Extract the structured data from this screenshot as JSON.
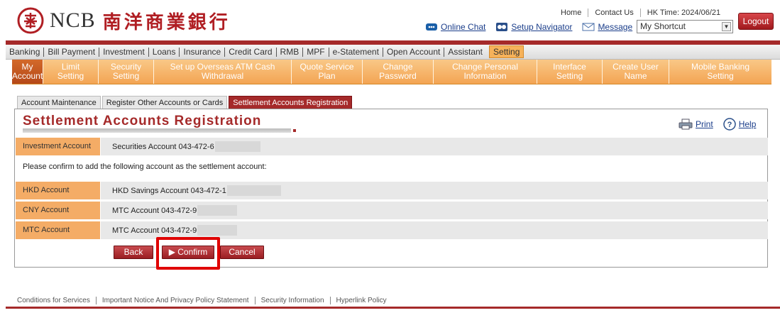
{
  "brand": {
    "name": "NCB",
    "chinese_name": "南洋商業銀行",
    "accent": "#a52a2a",
    "highlight": "#e00000"
  },
  "header": {
    "home": "Home",
    "contact": "Contact Us",
    "hk_time": "HK Time: 2024/06/21",
    "logout": "Logout",
    "tools": {
      "chat": "Online Chat",
      "navigator": "Setup Navigator",
      "message": "Message"
    },
    "shortcut": "My Shortcut"
  },
  "nav": {
    "items": [
      "Banking",
      "Bill Payment",
      "Investment",
      "Loans",
      "Insurance",
      "Credit Card",
      "RMB",
      "MPF",
      "e-Statement",
      "Open Account",
      "Assistant",
      "Setting"
    ]
  },
  "subnav": {
    "items": [
      {
        "l1": "My",
        "l2": "Account"
      },
      {
        "l1": "Limit",
        "l2": "Setting"
      },
      {
        "l1": "Security",
        "l2": "Setting"
      },
      {
        "l1": "Set up Overseas ATM Cash",
        "l2": "Withdrawal"
      },
      {
        "l1": "Quote Service",
        "l2": "Plan"
      },
      {
        "l1": "Change",
        "l2": "Password"
      },
      {
        "l1": "Change Personal",
        "l2": "Information"
      },
      {
        "l1": "Interface",
        "l2": "Setting"
      },
      {
        "l1": "Create User",
        "l2": "Name"
      },
      {
        "l1": "Mobile Banking",
        "l2": "Setting"
      }
    ]
  },
  "tabs": [
    "Account Maintenance",
    "Register Other Accounts or Cards",
    "Settlement Accounts Registration"
  ],
  "panel": {
    "title": "Settlement Accounts Registration",
    "print": "Print",
    "help": "Help",
    "investment_label": "Investment Account",
    "investment_value": "Securities Account 043-472-6",
    "confirm_text": "Please confirm to add the following account as the settlement account:",
    "rows": [
      {
        "label": "HKD Account",
        "value": "HKD Savings Account 043-472-1"
      },
      {
        "label": "CNY Account",
        "value": "MTC Account 043-472-9"
      },
      {
        "label": "MTC Account",
        "value": "MTC Account 043-472-9"
      }
    ],
    "buttons": {
      "back": "Back",
      "confirm": "Confirm",
      "cancel": "Cancel"
    }
  },
  "footer": [
    "Conditions for Services",
    "Important Notice And Privacy Policy Statement",
    "Security Information",
    "Hyperlink Policy"
  ]
}
